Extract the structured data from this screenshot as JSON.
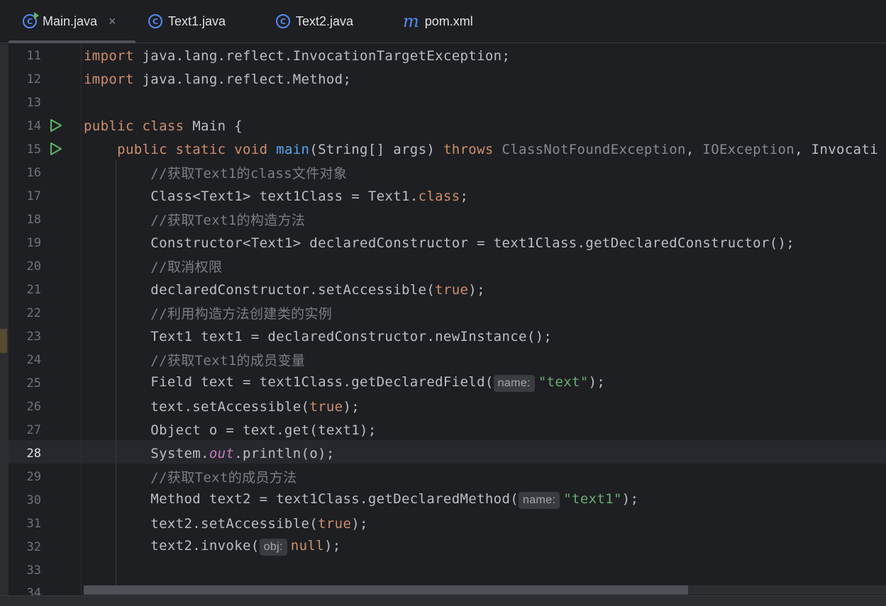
{
  "tabs": [
    {
      "label": "Main.java",
      "icon": "java-main-class-icon",
      "active": true
    },
    {
      "label": "Text1.java",
      "icon": "java-class-icon"
    },
    {
      "label": "Text2.java",
      "icon": "java-class-icon"
    },
    {
      "label": "pom.xml",
      "icon": "maven-icon"
    }
  ],
  "tab_close_glyph": "×",
  "editor": {
    "current_line": 28,
    "line_numbers": [
      "11",
      "12",
      "13",
      "14",
      "15",
      "16",
      "17",
      "18",
      "19",
      "20",
      "21",
      "22",
      "23",
      "24",
      "25",
      "26",
      "27",
      "28",
      "29",
      "30",
      "31",
      "32",
      "33",
      "34"
    ],
    "hints": {
      "name_hint": "name:",
      "obj_hint": "obj:"
    },
    "tokens": {
      "l11": [
        "import",
        " java.lang.reflect.InvocationTargetException;"
      ],
      "l12": [
        "import",
        " java.lang.reflect.Method;"
      ],
      "l14": [
        "public class",
        " Main {"
      ],
      "l15": [
        "    public static void ",
        "main",
        "(String[] args) ",
        "throws",
        " ClassNotFoundException",
        ", ",
        "IOException",
        ", Invocati"
      ],
      "l16": [
        "        //获取Text1的class文件对象"
      ],
      "l17": [
        "        Class<Text1> text1Class = Text1.",
        "class",
        ";"
      ],
      "l18": [
        "        //获取Text1的构造方法"
      ],
      "l19": [
        "        Constructor<Text1> declaredConstructor = text1Class.getDeclaredConstructor();"
      ],
      "l20": [
        "        //取消权限"
      ],
      "l21": [
        "        declaredConstructor.setAccessible(",
        "true",
        ");"
      ],
      "l22": [
        "        //利用构造方法创建类的实例"
      ],
      "l23": [
        "        Text1 text1 = declaredConstructor.newInstance();"
      ],
      "l24": [
        "        //获取Text1的成员变量"
      ],
      "l25": [
        "        Field text = text1Class.getDeclaredField(",
        "\"text\"",
        ");"
      ],
      "l26": [
        "        text.setAccessible(",
        "true",
        ");"
      ],
      "l27": [
        "        Object o = text.get(text1);"
      ],
      "l28": [
        "        System.",
        "out",
        ".println(o);"
      ],
      "l29": [
        "        //获取Text的成员方法"
      ],
      "l30": [
        "        Method text2 = text1Class.getDeclaredMethod(",
        "\"text1\"",
        ");"
      ],
      "l31": [
        "        text2.setAccessible(",
        "true",
        ");"
      ],
      "l32": [
        "        text2.invoke(",
        "null",
        ");"
      ]
    }
  },
  "colors": {
    "keyword": "#cf8e6d",
    "string": "#6aab73",
    "comment": "#7a7e85",
    "method": "#56a8f5",
    "static_field": "#c77dbb",
    "run_icon": "#5fb865"
  }
}
